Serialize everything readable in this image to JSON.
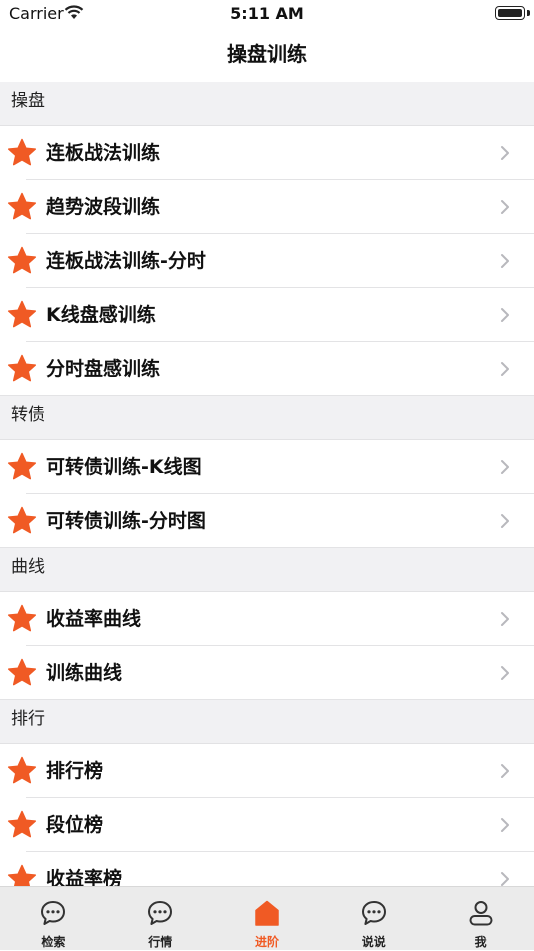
{
  "status_bar": {
    "carrier": "Carrier",
    "time": "5:11 AM"
  },
  "nav": {
    "title": "操盘训练"
  },
  "colors": {
    "accent": "#f05a24",
    "tab_bar_bg": "#ebebeb",
    "section_bg": "#f1f1f3"
  },
  "sections": [
    {
      "title": "操盘",
      "items": [
        {
          "label": "连板战法训练",
          "icon": "star-icon"
        },
        {
          "label": "趋势波段训练",
          "icon": "star-icon"
        },
        {
          "label": "连板战法训练-分时",
          "icon": "star-icon"
        },
        {
          "label": "K线盘感训练",
          "icon": "star-icon"
        },
        {
          "label": "分时盘感训练",
          "icon": "star-icon"
        }
      ]
    },
    {
      "title": "转债",
      "items": [
        {
          "label": "可转债训练-K线图",
          "icon": "star-icon"
        },
        {
          "label": "可转债训练-分时图",
          "icon": "star-icon"
        }
      ]
    },
    {
      "title": "曲线",
      "items": [
        {
          "label": "收益率曲线",
          "icon": "star-icon"
        },
        {
          "label": "训练曲线",
          "icon": "star-icon"
        }
      ]
    },
    {
      "title": "排行",
      "items": [
        {
          "label": "排行榜",
          "icon": "star-icon"
        },
        {
          "label": "段位榜",
          "icon": "star-icon"
        },
        {
          "label": "收益率榜",
          "icon": "star-icon"
        }
      ]
    }
  ],
  "tabs": [
    {
      "label": "检索",
      "icon": "chat-bubble-icon",
      "active": false
    },
    {
      "label": "行情",
      "icon": "chat-bubble-icon",
      "active": false
    },
    {
      "label": "进阶",
      "icon": "home-icon",
      "active": true
    },
    {
      "label": "说说",
      "icon": "chat-bubble-icon",
      "active": false
    },
    {
      "label": "我",
      "icon": "person-icon",
      "active": false
    }
  ]
}
